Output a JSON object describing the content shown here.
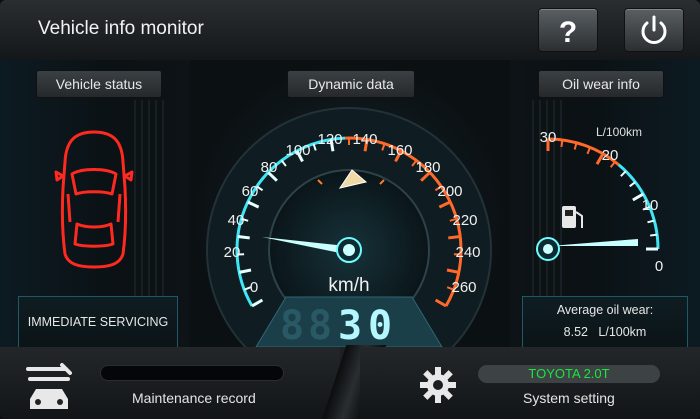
{
  "header": {
    "title": "Vehicle info monitor"
  },
  "panels": {
    "left": {
      "title": "Vehicle status",
      "status": "IMMEDIATE SERVICING"
    },
    "center": {
      "title": "Dynamic data",
      "unit": "km/h",
      "ticks": [
        "0",
        "20",
        "40",
        "60",
        "80",
        "100",
        "120",
        "140",
        "160",
        "180",
        "200",
        "220",
        "240",
        "260"
      ],
      "digits": [
        "8",
        "8",
        "3",
        "0"
      ]
    },
    "right": {
      "title": "Oil wear info",
      "unit": "L/100km",
      "ticks": [
        "30",
        "20",
        "10",
        "0"
      ],
      "avg_label": "Average oil wear:",
      "avg_value": "8.52",
      "avg_unit": "L/100km"
    }
  },
  "footer": {
    "maintenance_label": "Maintenance record",
    "car_model": "TOYOTA 2.0T",
    "settings_label": "System setting"
  },
  "colors": {
    "accent": "#3fe6f5",
    "warning": "#ff3b2f",
    "gauge_orange": "#ff7a2a",
    "car_model_text": "#19e83a"
  }
}
